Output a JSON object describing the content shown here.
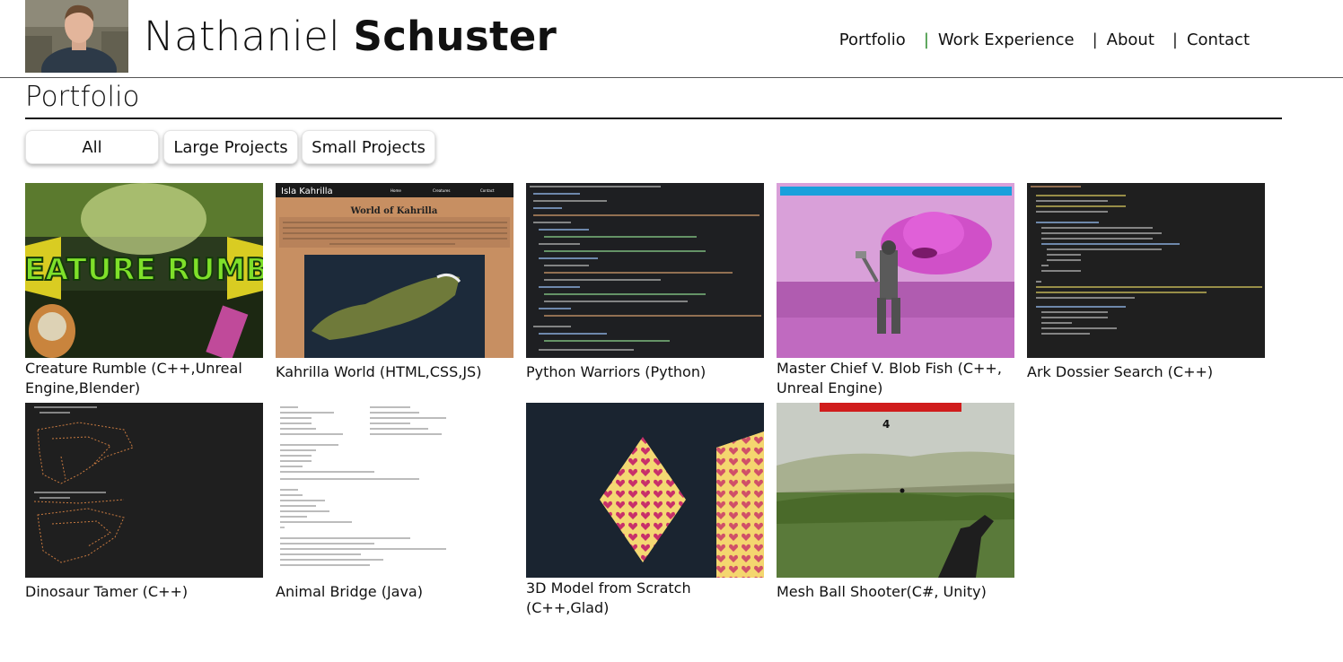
{
  "header": {
    "name_first": "Nathaniel",
    "name_last": "Schuster",
    "nav": [
      {
        "label": "Portfolio"
      },
      {
        "label": "Work Experience"
      },
      {
        "label": "About"
      },
      {
        "label": "Contact"
      }
    ],
    "separator": "|"
  },
  "page": {
    "title": "Portfolio",
    "filters": [
      "All",
      "Large Projects",
      "Small Projects"
    ]
  },
  "projects": [
    {
      "title": "Creature Rumble (C++,Unreal Engine,Blender)",
      "thumb_text": "CREATURE RUMBLE"
    },
    {
      "title": "Kahrilla World (HTML,CSS,JS)",
      "thumb_brand": "Isla Kahrilla",
      "thumb_heading": "World of Kahrilla",
      "thumb_nav": [
        "Home",
        "Creatures",
        "Contact"
      ]
    },
    {
      "title": "Python Warriors (Python)"
    },
    {
      "title": "Master Chief V. Blob Fish (C++, Unreal Engine)"
    },
    {
      "title": "Ark Dossier Search (C++)"
    },
    {
      "title": "Dinosaur Tamer (C++)"
    },
    {
      "title": "Animal Bridge (Java)"
    },
    {
      "title": "3D Model from Scratch (C++,Glad)"
    },
    {
      "title": "Mesh Ball Shooter(C#, Unity)",
      "thumb_counter": "4"
    }
  ],
  "colors": {
    "accent_separator": "#2a8a2a",
    "rule": "#111111"
  }
}
